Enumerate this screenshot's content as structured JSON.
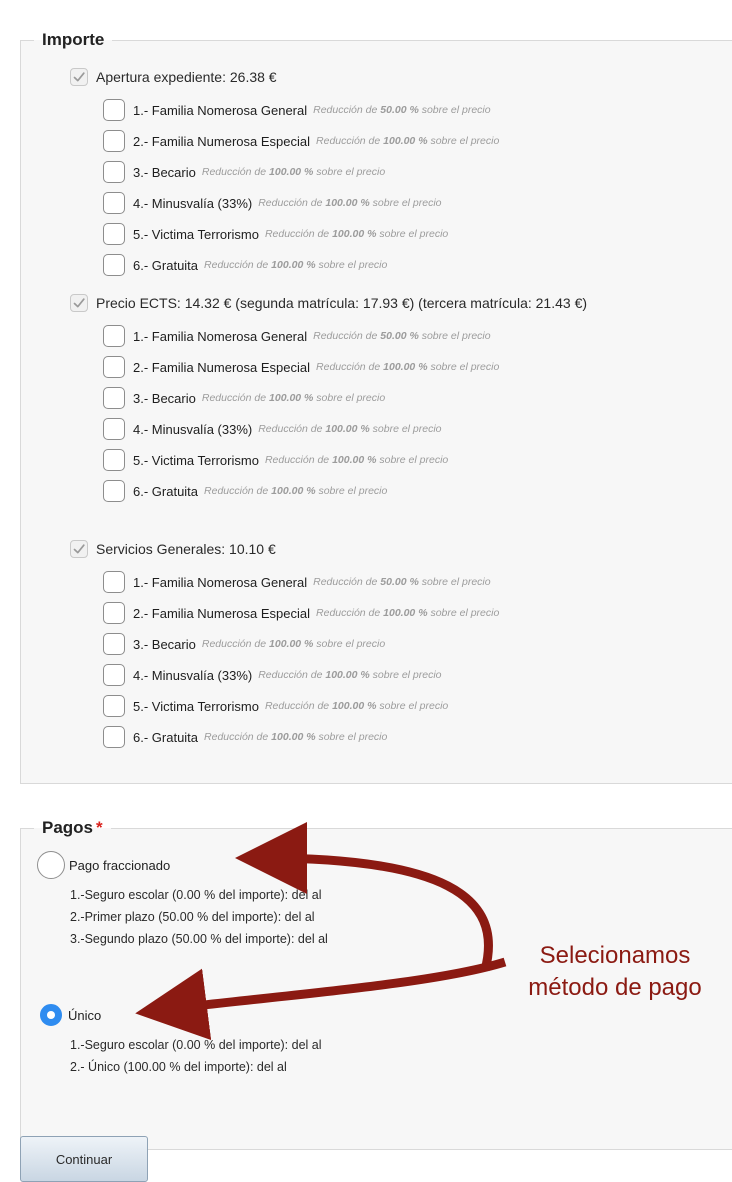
{
  "importe": {
    "legend": "Importe",
    "groups": [
      {
        "label": "Apertura expediente: 26.38 €",
        "options": [
          {
            "label": "1.- Familia Nomerosa General",
            "desc_pre": "Reducción de ",
            "desc_val": "50.00 %",
            "desc_post": " sobre el precio"
          },
          {
            "label": "2.- Familia Numerosa Especial",
            "desc_pre": "Reducción de ",
            "desc_val": "100.00 %",
            "desc_post": " sobre el precio"
          },
          {
            "label": "3.- Becario",
            "desc_pre": "Reducción de ",
            "desc_val": "100.00 %",
            "desc_post": " sobre el precio"
          },
          {
            "label": "4.- Minusvalía (33%)",
            "desc_pre": "Reducción de ",
            "desc_val": "100.00 %",
            "desc_post": " sobre el precio"
          },
          {
            "label": "5.- Victima Terrorismo",
            "desc_pre": "Reducción de ",
            "desc_val": "100.00 %",
            "desc_post": " sobre el precio"
          },
          {
            "label": "6.- Gratuita",
            "desc_pre": "Reducción de ",
            "desc_val": "100.00 %",
            "desc_post": " sobre el precio"
          }
        ]
      },
      {
        "label": "Precio ECTS: 14.32 €  (segunda matrícula: 17.93 €)  (tercera matrícula: 21.43 €)",
        "options": [
          {
            "label": "1.- Familia Nomerosa General",
            "desc_pre": "Reducción de ",
            "desc_val": "50.00 %",
            "desc_post": " sobre el precio"
          },
          {
            "label": "2.- Familia Numerosa Especial",
            "desc_pre": "Reducción de ",
            "desc_val": "100.00 %",
            "desc_post": " sobre el precio"
          },
          {
            "label": "3.- Becario",
            "desc_pre": "Reducción de ",
            "desc_val": "100.00 %",
            "desc_post": " sobre el precio"
          },
          {
            "label": "4.- Minusvalía (33%)",
            "desc_pre": "Reducción de ",
            "desc_val": "100.00 %",
            "desc_post": " sobre el precio"
          },
          {
            "label": "5.- Victima Terrorismo",
            "desc_pre": "Reducción de ",
            "desc_val": "100.00 %",
            "desc_post": " sobre el precio"
          },
          {
            "label": "6.- Gratuita",
            "desc_pre": "Reducción de ",
            "desc_val": "100.00 %",
            "desc_post": " sobre el precio"
          }
        ]
      },
      {
        "label": "Servicios Generales: 10.10 €",
        "options": [
          {
            "label": "1.- Familia Nomerosa General",
            "desc_pre": "Reducción de ",
            "desc_val": "50.00 %",
            "desc_post": " sobre el precio"
          },
          {
            "label": "2.- Familia Numerosa Especial",
            "desc_pre": "Reducción de ",
            "desc_val": "100.00 %",
            "desc_post": " sobre el precio"
          },
          {
            "label": "3.- Becario",
            "desc_pre": "Reducción de ",
            "desc_val": "100.00 %",
            "desc_post": " sobre el precio"
          },
          {
            "label": "4.- Minusvalía (33%)",
            "desc_pre": "Reducción de ",
            "desc_val": "100.00 %",
            "desc_post": " sobre el precio"
          },
          {
            "label": "5.- Victima Terrorismo",
            "desc_pre": "Reducción de ",
            "desc_val": "100.00 %",
            "desc_post": " sobre el precio"
          },
          {
            "label": "6.- Gratuita",
            "desc_pre": "Reducción de ",
            "desc_val": "100.00 %",
            "desc_post": " sobre el precio"
          }
        ]
      }
    ]
  },
  "pagos": {
    "legend": "Pagos",
    "required_mark": "*",
    "options": [
      {
        "label": "Pago fraccionado",
        "selected": false,
        "lines": [
          "1.-Seguro escolar (0.00 % del importe): del al",
          "2.-Primer plazo (50.00 % del importe): del al",
          "3.-Segundo plazo (50.00 % del importe): del al"
        ]
      },
      {
        "label": "Único",
        "selected": true,
        "lines": [
          "1.-Seguro escolar (0.00 % del importe): del al",
          "2.- Único (100.00 % del importe): del al"
        ]
      }
    ]
  },
  "annotation": {
    "line1": "Selecionamos",
    "line2": "método de pago"
  },
  "continue_label": "Continuar",
  "colors": {
    "arrow": "#8b1a12",
    "radio_selected": "#2f8cf0",
    "required": "#d9201b"
  }
}
